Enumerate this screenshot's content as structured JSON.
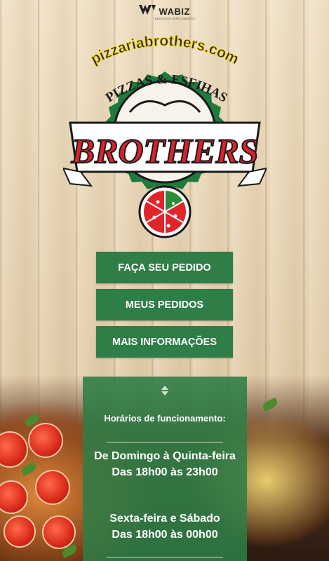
{
  "brand": {
    "name": "WABIZ",
    "tagline": "NEGÓCIOS INTELIGENTES"
  },
  "logo": {
    "url_text": "pizzariabrothers.com",
    "subtitle": "PIZZAS & ESFIHAS",
    "name": "BROTHERS"
  },
  "actions": {
    "order": "FAÇA SEU PEDIDO",
    "my_orders": "MEUS PEDIDOS",
    "more_info": "MAIS INFORMAÇÕES"
  },
  "hours": {
    "title": "Horários de funcionamento:",
    "schedule": [
      {
        "days": "De Domingo à Quinta-feira",
        "time": "Das 18h00 às 23h00"
      },
      {
        "days": "Sexta-feira e Sábado",
        "time": "Das 18h00 às 00h00"
      }
    ]
  },
  "colors": {
    "primary_green": "#2f7d47",
    "logo_red": "#d9232d",
    "wood": "#e6d3b4"
  }
}
